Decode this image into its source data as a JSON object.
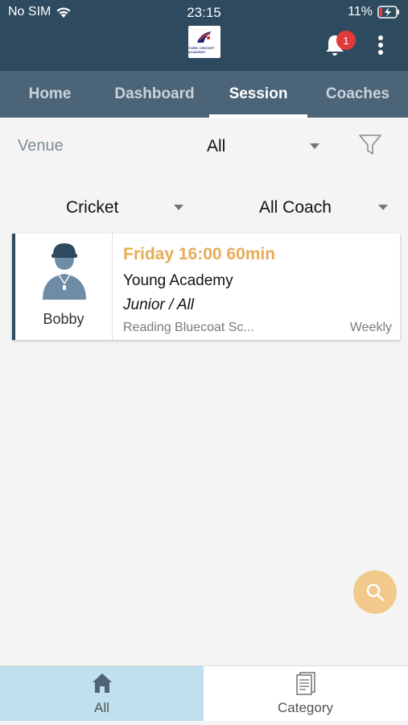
{
  "status_bar": {
    "carrier": "No SIM",
    "time": "23:15",
    "battery": "11%"
  },
  "header": {
    "logo_text": "YORK CRICKET ACADEMY",
    "notification_count": "1"
  },
  "tabs": [
    {
      "label": "Home",
      "active": false
    },
    {
      "label": "Dashboard",
      "active": false
    },
    {
      "label": "Session",
      "active": true
    },
    {
      "label": "Coaches",
      "active": false
    }
  ],
  "filters": {
    "venue_label": "Venue",
    "venue_value": "All",
    "sport_value": "Cricket",
    "coach_value": "All Coach"
  },
  "sessions": [
    {
      "coach": "Bobby",
      "time": "Friday 16:00 60min",
      "name": "Young Academy",
      "level": "Junior / All",
      "location": "Reading Bluecoat Sc...",
      "frequency": "Weekly"
    }
  ],
  "bottom_nav": [
    {
      "label": "All",
      "icon": "home-icon",
      "active": true
    },
    {
      "label": "Category",
      "icon": "document-icon",
      "active": false
    }
  ],
  "colors": {
    "header_bg": "#2d4a5e",
    "tab_bg": "#4b6478",
    "accent_orange": "#e7ac57",
    "fab_bg": "#f2c98d",
    "nav_active_bg": "#bfe0ec"
  }
}
